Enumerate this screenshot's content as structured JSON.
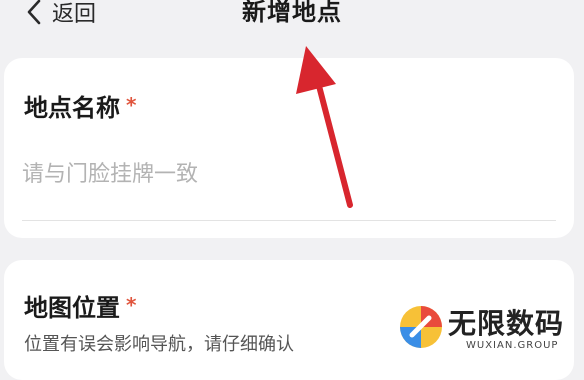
{
  "header": {
    "back_label": "返回",
    "title": "新增地点"
  },
  "form": {
    "name_field": {
      "label": "地点名称",
      "required_mark": "*",
      "placeholder": "请与门脸挂牌一致",
      "value": ""
    },
    "location_field": {
      "label": "地图位置",
      "required_mark": "*",
      "hint": "位置有误会影响导航，请仔细确认"
    }
  },
  "watermark": {
    "text": "无限数码",
    "subtext": "WUXIAN.GROUP"
  },
  "colors": {
    "background": "#f1f1f3",
    "card": "#ffffff",
    "required": "#e0553d",
    "annotation_arrow": "#d8262e"
  },
  "icons": {
    "back": "chevron-left-icon",
    "annotation": "red-arrow-icon",
    "logo": "wuxian-logo-icon"
  }
}
